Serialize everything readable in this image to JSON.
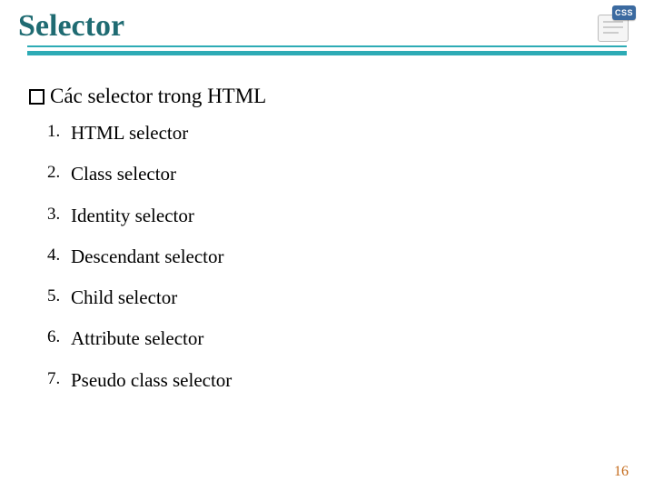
{
  "title": "Selector",
  "icon_badge_text": "CSS",
  "heading": "Các selector trong HTML",
  "items": [
    "HTML selector",
    "Class selector",
    "Identity selector",
    "Descendant selector",
    "Child selector",
    "Attribute selector",
    "Pseudo class selector"
  ],
  "page_number": "16"
}
